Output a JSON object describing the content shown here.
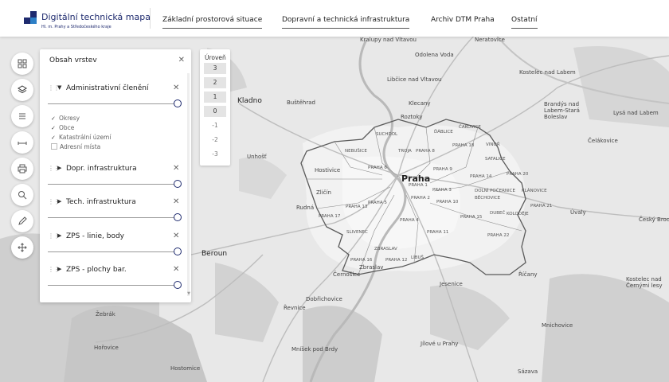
{
  "header": {
    "title": "Digitální technická mapa",
    "subtitle": "Hl. m. Prahy a Středočeského kraje",
    "tabs": [
      "Základní prostorová situace",
      "Dopravní a technická infrastruktura",
      "Archiv DTM Praha",
      "Ostatní"
    ]
  },
  "tools": [
    {
      "icon": "grid-icon"
    },
    {
      "icon": "layers-icon"
    },
    {
      "icon": "list-icon"
    },
    {
      "icon": "measure-icon"
    },
    {
      "icon": "print-icon"
    },
    {
      "icon": "search-location-icon"
    },
    {
      "icon": "pencil-icon"
    },
    {
      "icon": "move-icon"
    }
  ],
  "panel": {
    "title": "Obsah vrstev",
    "layers": [
      {
        "name": "Administrativní členění",
        "expanded": true,
        "sublayers": [
          {
            "name": "Okresy",
            "checked": true
          },
          {
            "name": "Obce",
            "checked": true
          },
          {
            "name": "Katastrální území",
            "checked": true
          },
          {
            "name": "Adresní místa",
            "checked": false
          }
        ]
      },
      {
        "name": "Dopr. infrastruktura",
        "expanded": false
      },
      {
        "name": "Tech. infrastruktura",
        "expanded": false
      },
      {
        "name": "ZPS - linie, body",
        "expanded": false
      },
      {
        "name": "ZPS - plochy bar.",
        "expanded": false
      }
    ]
  },
  "levels": {
    "title": "Úroveň",
    "items": [
      "3",
      "2",
      "1",
      "0",
      "-1",
      "-2",
      "-3"
    ],
    "active": [
      "3",
      "2",
      "1",
      "0"
    ]
  },
  "map_labels": {
    "towns": [
      "Kralupy nad Vltavou",
      "Odolena Voda",
      "Neratovice",
      "Libčice nad Vltavou",
      "Kostelec nad Labem",
      "Kladno",
      "Buštěhrad",
      "Klecany",
      "Brandýs nad Labem-Stará Boleslav",
      "Lysá nad Labem",
      "Roztoky",
      "Čelákovice",
      "Unhošť",
      "Hostivice",
      "Praha",
      "Úvaly",
      "Český Brod",
      "Rudná",
      "Zličín",
      "Beroun",
      "Řevnice",
      "Dobřichovice",
      "Jesenice",
      "Říčany",
      "Kostelec nad Černými lesy",
      "Žebrák",
      "Hořovice",
      "Mníšek pod Brdy",
      "Jílové u Prahy",
      "Mnichovice",
      "Hostomice",
      "Sázava",
      "Černošice",
      "Zbraslav"
    ],
    "districts": [
      "SUCHDOL",
      "ČAKOVICE",
      "ĎÁBLICE",
      "VINOŘ",
      "NEBUŠICE",
      "TROJA",
      "PRAHA 8",
      "PRAHA 18",
      "SATALICE",
      "PRAHA 6",
      "PRAHA 9",
      "PRAHA 14",
      "PRAHA 20",
      "PRAHA 1",
      "PRAHA 2",
      "PRAHA 3",
      "PRAHA 10",
      "DOLNÍ POČERNICE",
      "KLÁNOVICE",
      "BĚCHOVICE",
      "PRAHA 13",
      "PRAHA 5",
      "PRAHA 15",
      "PRAHA 4",
      "DUBEČ",
      "KOLODĚJE",
      "PRAHA 21",
      "SLIVENEC",
      "PRAHA 11",
      "PRAHA 22",
      "PRAHA 12",
      "LIBUŠ",
      "PRAHA 16",
      "ZBRASLAV",
      "PRAHA 17"
    ]
  }
}
